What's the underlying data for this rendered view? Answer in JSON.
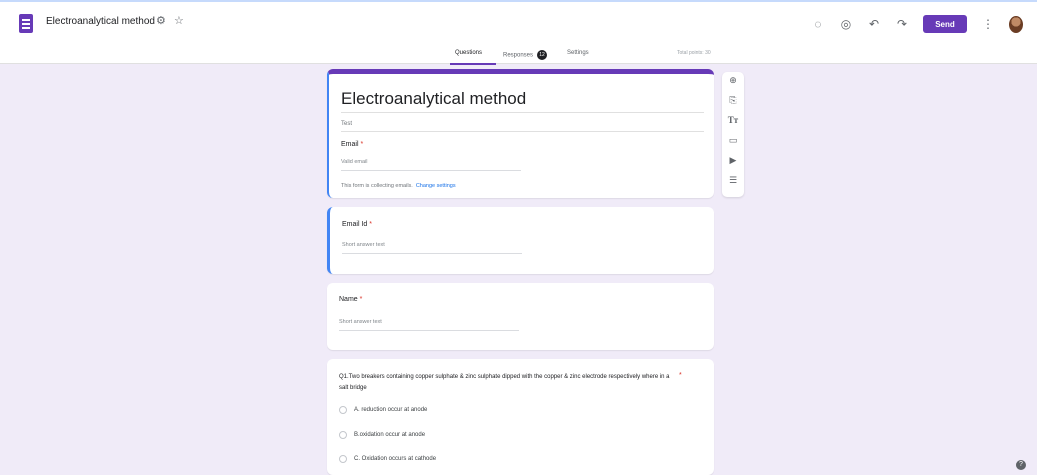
{
  "app": {
    "doc_title": "Electroanalytical method",
    "send_label": "Send"
  },
  "tabs": [
    {
      "label": "Questions"
    },
    {
      "label": "Responses",
      "badge": "12"
    },
    {
      "label": "Settings"
    }
  ],
  "total_points": "Total points: 30",
  "header_card": {
    "title": "Electroanalytical method",
    "description": "Test",
    "email_label": "Email",
    "email_placeholder": "Valid email",
    "collecting_note": "This form is collecting emails.",
    "change_settings": "Change settings"
  },
  "questions": [
    {
      "label": "Email Id",
      "placeholder": "Short answer text"
    },
    {
      "label": "Name",
      "placeholder": "Short answer text"
    }
  ],
  "q1": {
    "text": "Q1.Two breakers containing copper sulphate & zinc sulphate dipped with the copper & zinc electrode respectively where in a salt bridge",
    "options": [
      "A. reduction occur at anode",
      "B.oxidation occur at anode",
      "C. Oxidation occurs at cathode"
    ]
  },
  "required_mark": "*",
  "colors": {
    "accent": "#673ab7",
    "active_border": "#4285f4",
    "background": "#f0ebf8",
    "required": "#d93025",
    "link": "#1a73e8"
  },
  "icons": {
    "top_bar": [
      "palette-icon",
      "preview-eye-icon",
      "undo-icon",
      "redo-icon",
      "more-vert-icon"
    ],
    "side_tools": [
      "add-question-icon",
      "import-questions-icon",
      "add-title-icon",
      "add-image-icon",
      "add-video-icon",
      "add-section-icon"
    ]
  }
}
